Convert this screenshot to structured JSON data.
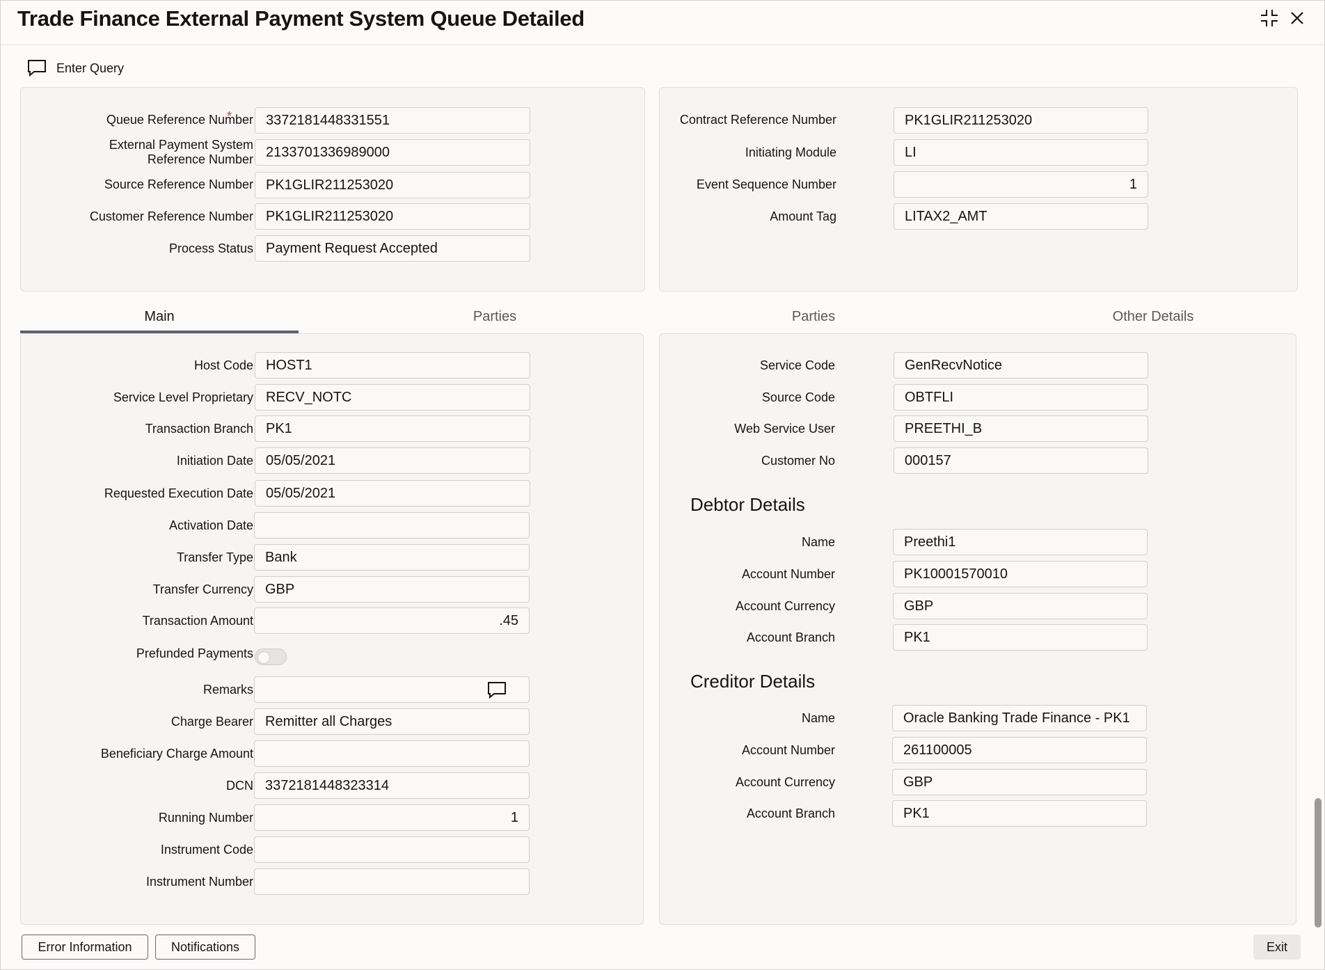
{
  "window": {
    "title": "Trade Finance External Payment System Queue Detailed"
  },
  "toolbar": {
    "enter_query": "Enter Query"
  },
  "header_left": {
    "queue_ref_label": "Queue Reference Number",
    "queue_ref_value": "3372181448331551",
    "ext_ref_label_1": "External Payment System",
    "ext_ref_label_2": "Reference Number",
    "ext_ref_value": "2133701336989000",
    "source_ref_label": "Source Reference Number",
    "source_ref_value": "PK1GLIR211253020",
    "cust_ref_label": "Customer Reference Number",
    "cust_ref_value": "PK1GLIR211253020",
    "process_status_label": "Process Status",
    "process_status_value": "Payment Request Accepted"
  },
  "header_right": {
    "contract_ref_label": "Contract Reference Number",
    "contract_ref_value": "PK1GLIR211253020",
    "init_module_label": "Initiating Module",
    "init_module_value": "LI",
    "event_seq_label": "Event Sequence Number",
    "event_seq_value": "1",
    "amount_tag_label": "Amount Tag",
    "amount_tag_value": "LITAX2_AMT"
  },
  "tabs": [
    "Main",
    "Parties",
    "Parties",
    "Other Details"
  ],
  "main_left": {
    "host_code_label": "Host Code",
    "host_code_value": "HOST1",
    "slp_label": "Service Level Proprietary",
    "slp_value": "RECV_NOTC",
    "txn_branch_label": "Transaction Branch",
    "txn_branch_value": "PK1",
    "init_date_label": "Initiation Date",
    "init_date_value": "05/05/2021",
    "req_exec_label": "Requested Execution Date",
    "req_exec_value": "05/05/2021",
    "activation_label": "Activation Date",
    "activation_value": "",
    "transfer_type_label": "Transfer Type",
    "transfer_type_value": "Bank",
    "transfer_ccy_label": "Transfer Currency",
    "transfer_ccy_value": "GBP",
    "txn_amount_label": "Transaction Amount",
    "txn_amount_value": ".45",
    "prefunded_label": "Prefunded Payments",
    "remarks_label": "Remarks",
    "remarks_value": "",
    "charge_bearer_label": "Charge Bearer",
    "charge_bearer_value": "Remitter all Charges",
    "ben_charge_label": "Beneficiary Charge Amount",
    "ben_charge_value": "",
    "dcn_label": "DCN",
    "dcn_value": "3372181448323314",
    "running_no_label": "Running Number",
    "running_no_value": "1",
    "instr_code_label": "Instrument Code",
    "instr_code_value": "",
    "instr_no_label": "Instrument Number",
    "instr_no_value": ""
  },
  "main_right": {
    "service_code_label": "Service Code",
    "service_code_value": "GenRecvNotice",
    "source_code_label": "Source Code",
    "source_code_value": "OBTFLI",
    "ws_user_label": "Web Service User",
    "ws_user_value": "PREETHI_B",
    "cust_no_label": "Customer No",
    "cust_no_value": "000157",
    "debtor_heading": "Debtor Details",
    "debtor_name_label": "Name",
    "debtor_name_value": "Preethi1",
    "debtor_acc_label": "Account Number",
    "debtor_acc_value": "PK10001570010",
    "debtor_ccy_label": "Account Currency",
    "debtor_ccy_value": "GBP",
    "debtor_branch_label": "Account Branch",
    "debtor_branch_value": "PK1",
    "creditor_heading": "Creditor Details",
    "creditor_name_label": "Name",
    "creditor_name_value": "Oracle Banking Trade Finance - PK1",
    "creditor_acc_label": "Account Number",
    "creditor_acc_value": "261100005",
    "creditor_ccy_label": "Account Currency",
    "creditor_ccy_value": "GBP",
    "creditor_branch_label": "Account Branch",
    "creditor_branch_value": "PK1"
  },
  "footer": {
    "error_info": "Error Information",
    "notifications": "Notifications",
    "exit": "Exit"
  }
}
